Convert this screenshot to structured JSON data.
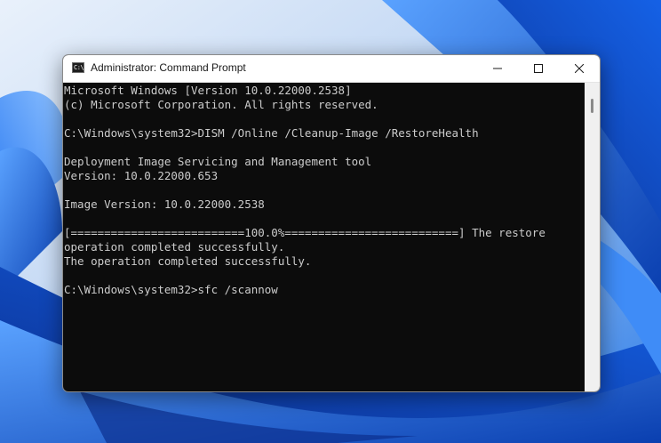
{
  "window": {
    "title": "Administrator: Command Prompt",
    "icon": "cmd-icon",
    "controls": [
      "minimize-icon",
      "maximize-icon",
      "close-icon"
    ]
  },
  "console": {
    "lines": [
      "Microsoft Windows [Version 10.0.22000.2538]",
      "(c) Microsoft Corporation. All rights reserved.",
      "",
      "C:\\Windows\\system32>DISM /Online /Cleanup-Image /RestoreHealth",
      "",
      "Deployment Image Servicing and Management tool",
      "Version: 10.0.22000.653",
      "",
      "Image Version: 10.0.22000.2538",
      "",
      "[==========================100.0%==========================] The restore",
      "operation completed successfully.",
      "The operation completed successfully.",
      "",
      "C:\\Windows\\system32>sfc /scannow"
    ]
  },
  "colors": {
    "console_background": "#0c0c0c",
    "console_text": "#cccccc",
    "titlebar": "#ffffff",
    "wallpaper_blue": "#1c6fe0"
  }
}
